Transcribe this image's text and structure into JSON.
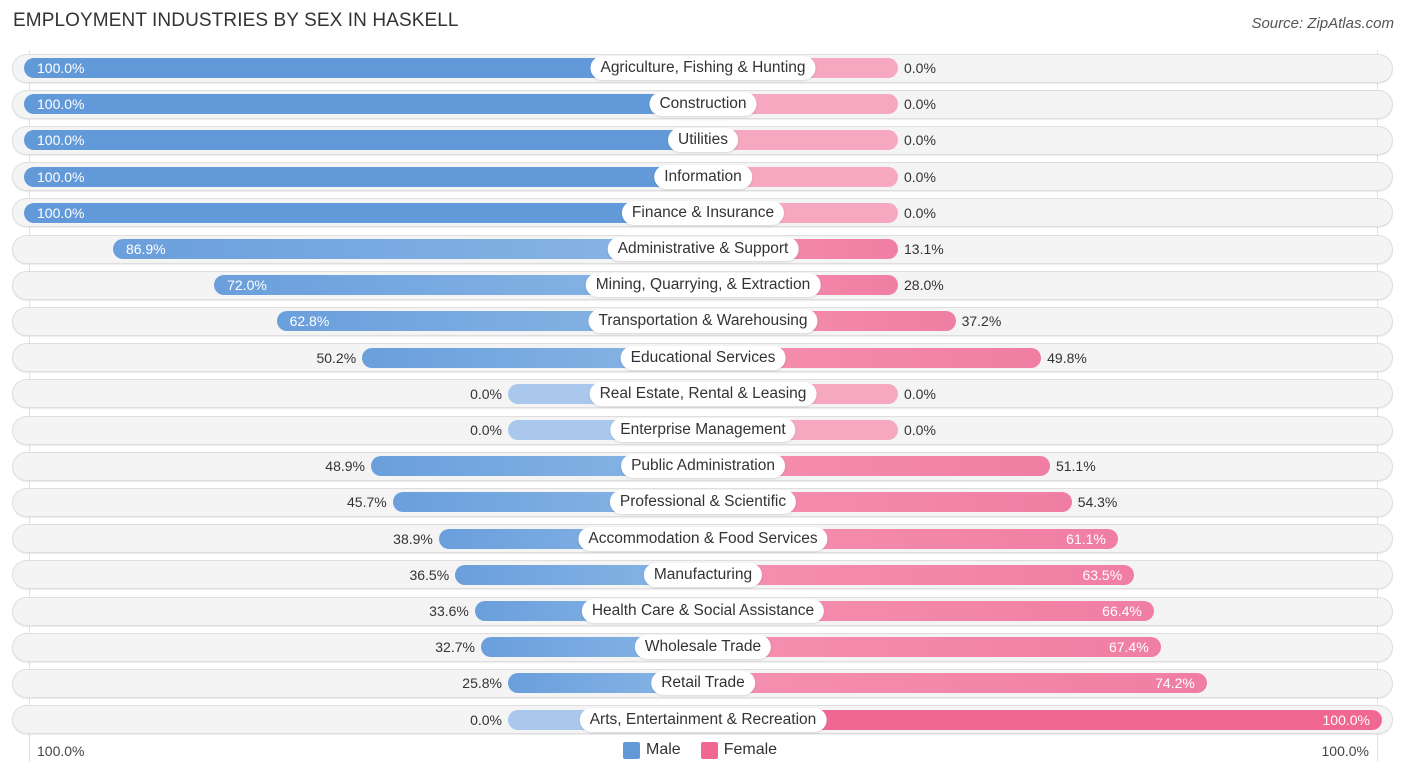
{
  "header": {
    "title": "EMPLOYMENT INDUSTRIES BY SEX IN HASKELL",
    "source": "Source: ZipAtlas.com"
  },
  "colors": {
    "male": "#6299d9",
    "male_light": "#a9c8ec",
    "female": "#f06892",
    "female_light": "#f5a8c0"
  },
  "chart_data": {
    "type": "bar",
    "orientation": "horizontal-diverging",
    "title": "EMPLOYMENT INDUSTRIES BY SEX IN HASKELL",
    "xlabel": "",
    "ylabel": "",
    "xlim": [
      -100,
      100
    ],
    "axis_labels": {
      "left": "100.0%",
      "right": "100.0%"
    },
    "legend": {
      "position": "bottom-center",
      "items": [
        "Male",
        "Female"
      ]
    },
    "categories": [
      "Agriculture, Fishing & Hunting",
      "Construction",
      "Utilities",
      "Information",
      "Finance & Insurance",
      "Administrative & Support",
      "Mining, Quarrying, & Extraction",
      "Transportation & Warehousing",
      "Educational Services",
      "Real Estate, Rental & Leasing",
      "Enterprise Management",
      "Public Administration",
      "Professional & Scientific",
      "Accommodation & Food Services",
      "Manufacturing",
      "Health Care & Social Assistance",
      "Wholesale Trade",
      "Retail Trade",
      "Arts, Entertainment & Recreation"
    ],
    "series": [
      {
        "name": "Male",
        "values": [
          100.0,
          100.0,
          100.0,
          100.0,
          100.0,
          86.9,
          72.0,
          62.8,
          50.2,
          0.0,
          0.0,
          48.9,
          45.7,
          38.9,
          36.5,
          33.6,
          32.7,
          25.8,
          0.0
        ]
      },
      {
        "name": "Female",
        "values": [
          0.0,
          0.0,
          0.0,
          0.0,
          0.0,
          13.1,
          28.0,
          37.2,
          49.8,
          0.0,
          0.0,
          51.1,
          54.3,
          61.1,
          63.5,
          66.4,
          67.4,
          74.2,
          100.0
        ]
      }
    ],
    "labels": {
      "Male": [
        "100.0%",
        "100.0%",
        "100.0%",
        "100.0%",
        "100.0%",
        "86.9%",
        "72.0%",
        "62.8%",
        "50.2%",
        "0.0%",
        "0.0%",
        "48.9%",
        "45.7%",
        "38.9%",
        "36.5%",
        "33.6%",
        "32.7%",
        "25.8%",
        "0.0%"
      ],
      "Female": [
        "0.0%",
        "0.0%",
        "0.0%",
        "0.0%",
        "0.0%",
        "13.1%",
        "28.0%",
        "37.2%",
        "49.8%",
        "0.0%",
        "0.0%",
        "51.1%",
        "54.3%",
        "61.1%",
        "63.5%",
        "66.4%",
        "67.4%",
        "74.2%",
        "100.0%"
      ]
    }
  }
}
